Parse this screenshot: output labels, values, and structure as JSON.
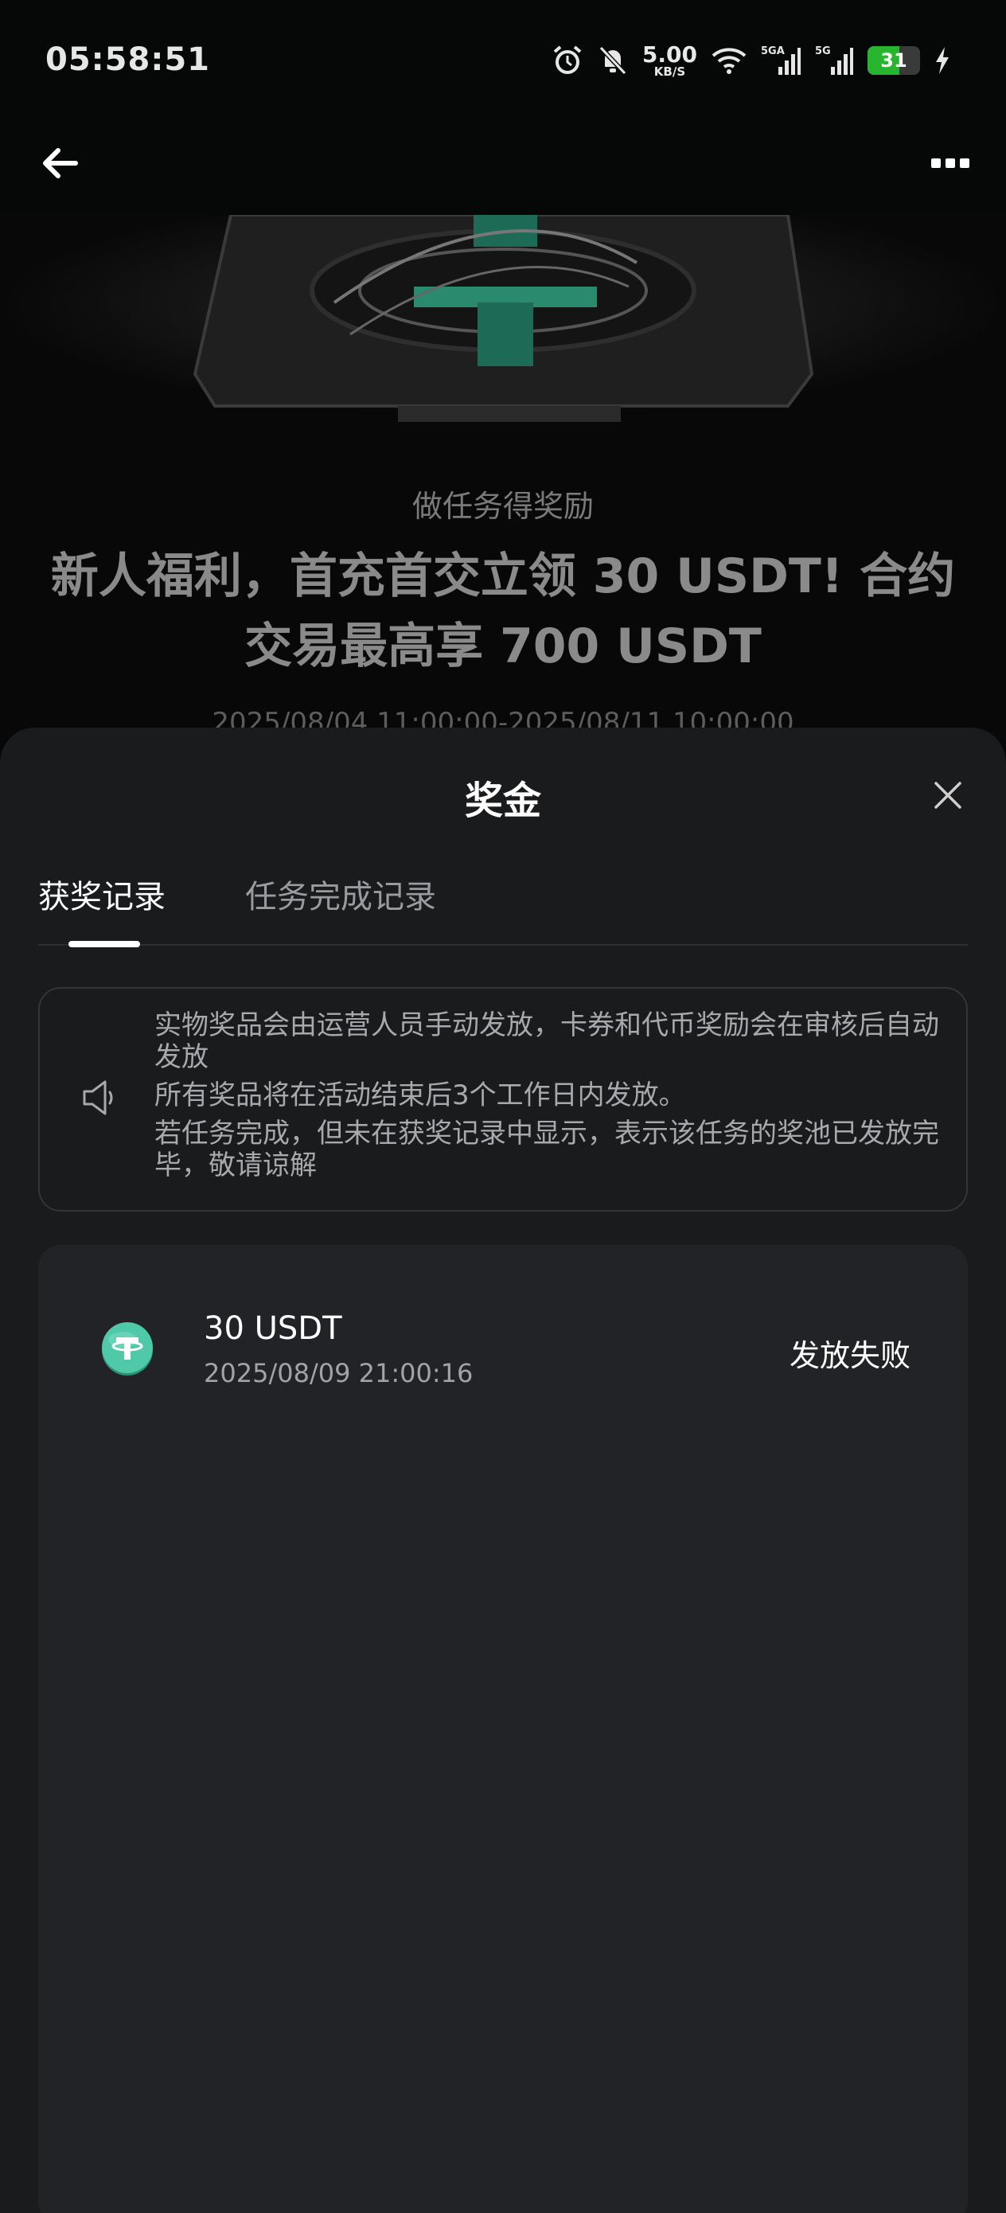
{
  "status_bar": {
    "time": "05:58:51",
    "net_speed": "5.00",
    "net_unit": "KB/S",
    "signal_1": "5GA",
    "signal_2": "5G",
    "battery": "31",
    "icons": [
      "alarm-icon",
      "mute-icon",
      "wifi-icon",
      "signal-icon",
      "signal-icon",
      "battery-icon",
      "charging-icon"
    ]
  },
  "nav": {
    "back_icon": "arrow-left-icon",
    "more_icon": "more-dots-icon"
  },
  "hero": {
    "subtitle": "做任务得奖励",
    "title": "新人福利，首充首交立领 30 USDT! 合约交易最高享 700 USDT",
    "dates": "2025/08/04 11:00:00-2025/08/11 10:00:00"
  },
  "sheet": {
    "title": "奖金",
    "close_icon": "close-icon",
    "tabs": [
      {
        "label": "获奖记录",
        "active": true
      },
      {
        "label": "任务完成记录",
        "active": false
      }
    ],
    "notice": {
      "icon": "speaker-icon",
      "lines": [
        "实物奖品会由运营人员手动发放，卡券和代币奖励会在审核后自动发放",
        "所有奖品将在活动结束后3个工作日内发放。",
        "若任务完成，但未在获奖记录中显示，表示该任务的奖池已发放完毕，敬请谅解"
      ]
    },
    "records": [
      {
        "icon": "usdt-icon",
        "amount": "30 USDT",
        "time": "2025/08/09 21:00:16",
        "status": "发放失败"
      }
    ]
  },
  "colors": {
    "sheet_bg": "#1a1b1d",
    "card_bg": "#222327",
    "usdt_green": "#3fbfa0"
  }
}
